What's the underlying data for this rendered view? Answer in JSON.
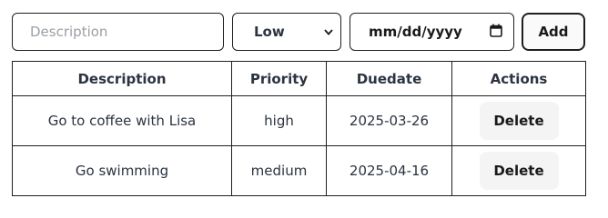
{
  "form": {
    "description_placeholder": "Description",
    "description_value": "",
    "priority_selected": "Low",
    "date_placeholder": "mm/dd/yyyy",
    "add_label": "Add",
    "icons": {
      "select": "chevron-down-icon",
      "date": "calendar-icon"
    }
  },
  "table": {
    "headers": [
      "Description",
      "Priority",
      "Duedate",
      "Actions"
    ],
    "rows": [
      {
        "description": "Go to coffee with Lisa",
        "priority": "high",
        "duedate": "2025-03-26",
        "action": "Delete"
      },
      {
        "description": "Go swimming",
        "priority": "medium",
        "duedate": "2025-04-16",
        "action": "Delete"
      }
    ]
  }
}
